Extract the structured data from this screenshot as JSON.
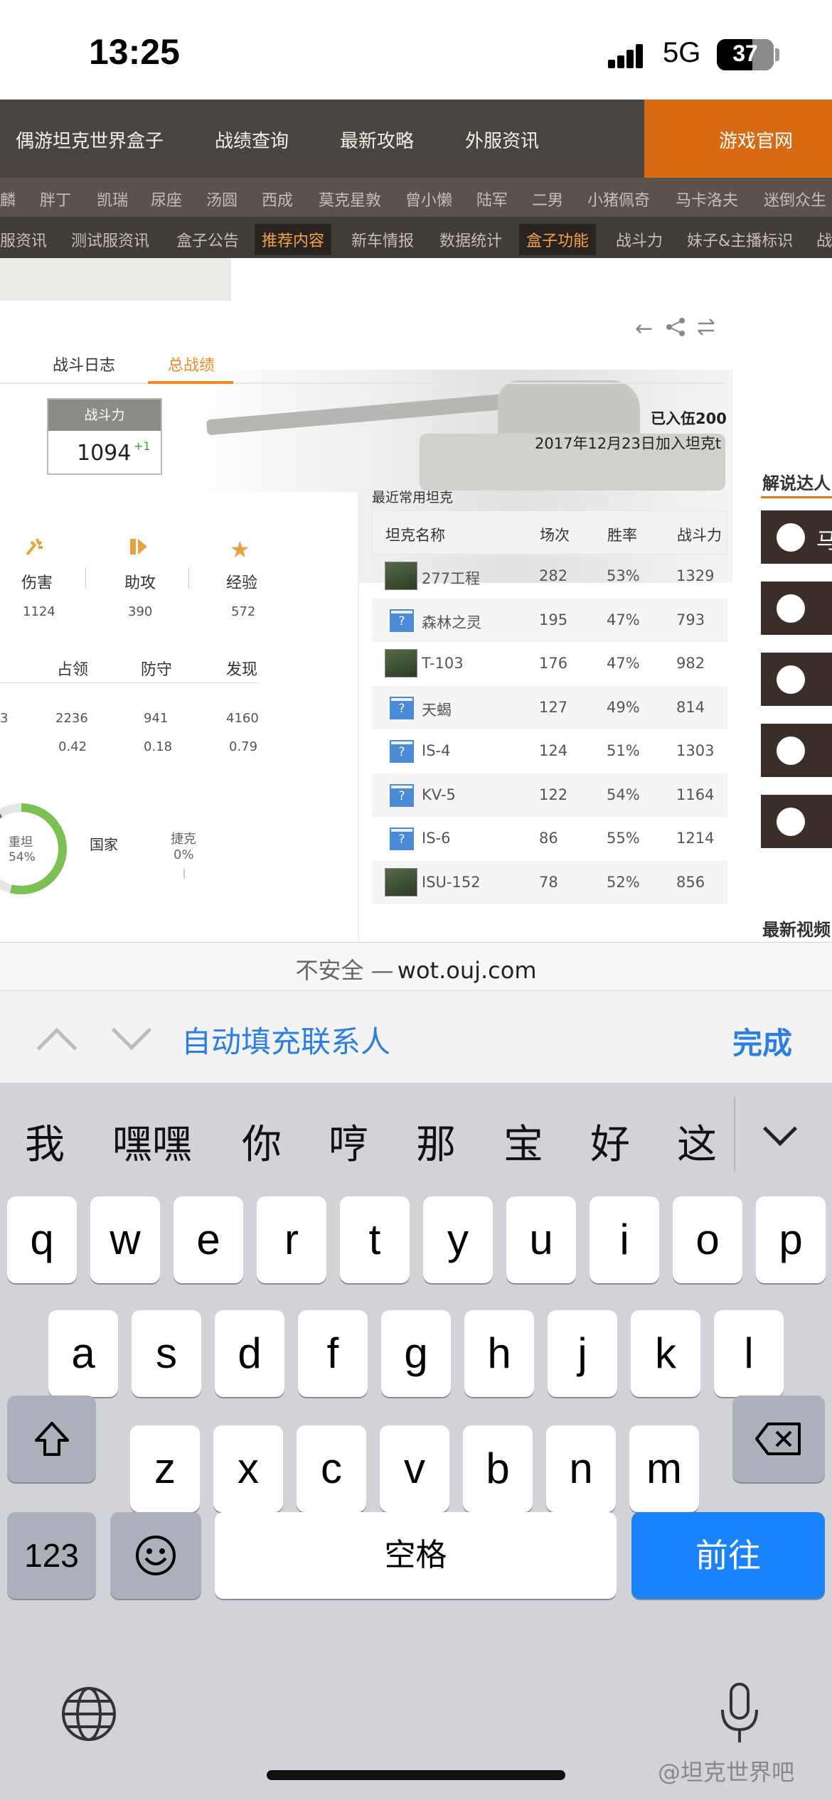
{
  "status_bar": {
    "time": "13:25",
    "network": "5G",
    "battery": "37"
  },
  "site_nav": {
    "items": [
      "偶游坦克世界盒子",
      "战绩查询",
      "最新攻略",
      "外服资讯"
    ],
    "official": "游戏官网",
    "row2": [
      "麟",
      "胖丁",
      "凯瑞",
      "尿座",
      "汤圆",
      "西成",
      "莫克星敦",
      "曾小懒",
      "陆军",
      "二男",
      "小猪佩奇",
      "马卡洛夫",
      "迷倒众生"
    ],
    "row3": [
      "服资讯",
      "测试服资讯",
      "盒子公告",
      "推荐内容",
      "新车情报",
      "数据统计",
      "盒子功能",
      "战斗力",
      "妹子&主播标识",
      "战"
    ],
    "row3_highlight": [
      "推荐内容",
      "盒子功能"
    ]
  },
  "tabs": {
    "battle_log": "战斗日志",
    "total": "总战绩"
  },
  "power": {
    "label": "战斗力",
    "value": "1094",
    "delta": "+1"
  },
  "joined": {
    "line1": "已入伍200",
    "line2": "2017年12月23日加入坦克t"
  },
  "stats_top": [
    {
      "label": "伤害",
      "value": "1124",
      "icon": "damage-icon"
    },
    {
      "label": "助攻",
      "value": "390",
      "icon": "assist-icon"
    },
    {
      "label": "经验",
      "value": "572",
      "icon": "star-icon"
    }
  ],
  "stats_mid": {
    "headers": [
      "占领",
      "防守",
      "发现"
    ],
    "row1": [
      "2236",
      "941",
      "4160"
    ],
    "row2": [
      "0.42",
      "0.18",
      "0.79"
    ],
    "partial_left": "3"
  },
  "donut": {
    "label": "重坦",
    "percent": "54%",
    "nation": "国家",
    "country": "捷克",
    "country_pct": "0%",
    "fill_fraction": 0.54
  },
  "recent_tanks": {
    "title": "最近常用坦克",
    "headers": [
      "坦克名称",
      "场次",
      "胜率",
      "战斗力"
    ],
    "rows": [
      {
        "name": "277工程",
        "battles": "282",
        "win": "53%",
        "power": "1329",
        "img": "tank"
      },
      {
        "name": "森林之灵",
        "battles": "195",
        "win": "47%",
        "power": "793",
        "img": "unknown"
      },
      {
        "name": "T-103",
        "battles": "176",
        "win": "47%",
        "power": "982",
        "img": "tank"
      },
      {
        "name": "天蝎",
        "battles": "127",
        "win": "49%",
        "power": "814",
        "img": "unknown"
      },
      {
        "name": "IS-4",
        "battles": "124",
        "win": "51%",
        "power": "1303",
        "img": "unknown"
      },
      {
        "name": "KV-5",
        "battles": "122",
        "win": "54%",
        "power": "1164",
        "img": "unknown"
      },
      {
        "name": "IS-6",
        "battles": "86",
        "win": "55%",
        "power": "1214",
        "img": "unknown"
      },
      {
        "name": "ISU-152",
        "battles": "78",
        "win": "52%",
        "power": "856",
        "img": "tank"
      }
    ]
  },
  "right_col": {
    "title1": "解说达人",
    "partial_name": "马",
    "title2": "最新视频"
  },
  "url": {
    "insecure": "不安全 —",
    "host": "wot.ouj.com"
  },
  "autofill": {
    "label": "自动填充联系人",
    "done": "完成"
  },
  "keyboard": {
    "candidates": [
      "我",
      "嘿嘿",
      "你",
      "哼",
      "那",
      "宝",
      "好",
      "这"
    ],
    "row1": [
      "q",
      "w",
      "e",
      "r",
      "t",
      "y",
      "u",
      "i",
      "o",
      "p"
    ],
    "row2": [
      "a",
      "s",
      "d",
      "f",
      "g",
      "h",
      "j",
      "k",
      "l"
    ],
    "row3": [
      "z",
      "x",
      "c",
      "v",
      "b",
      "n",
      "m"
    ],
    "num": "123",
    "space": "空格",
    "go": "前往"
  },
  "watermark": "@坦克世界吧"
}
